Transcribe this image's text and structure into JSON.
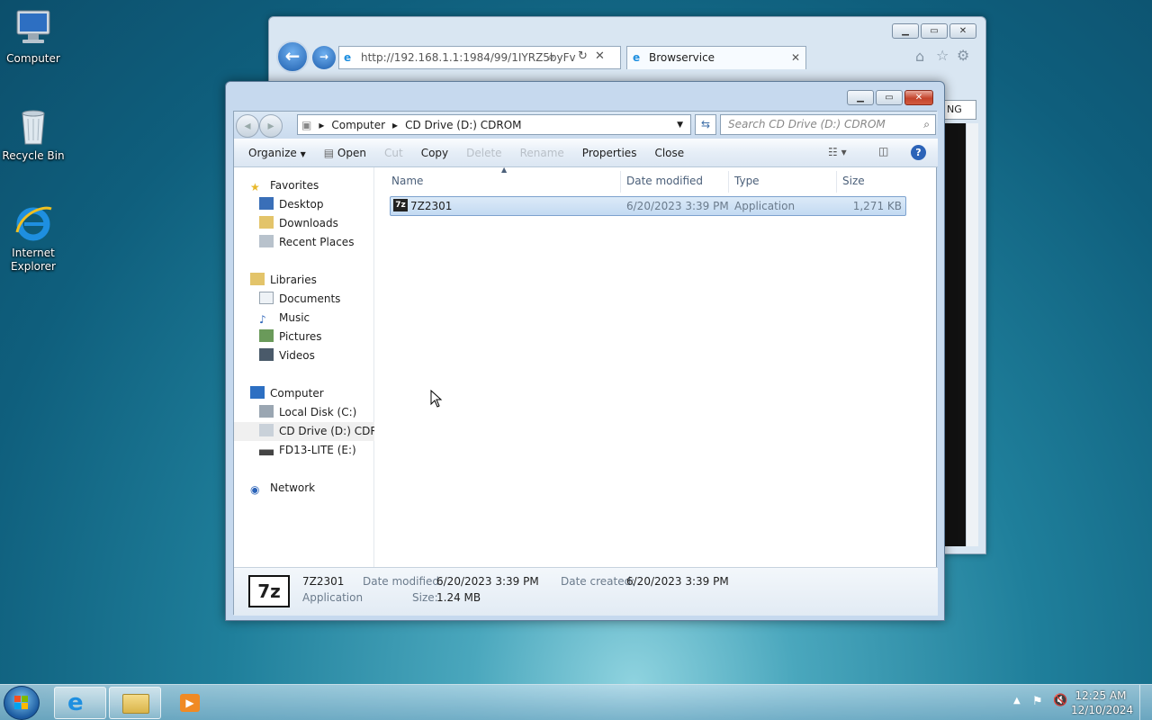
{
  "desktop": {
    "icons": [
      {
        "label": "Computer",
        "icon": "computer-icon"
      },
      {
        "label": "Recycle Bin",
        "icon": "recycle-bin-icon"
      },
      {
        "label": "Internet Explorer",
        "icon": "internet-explorer-icon"
      }
    ]
  },
  "browser": {
    "address": "http://192.168.1.1:1984/99/1IYRZ5byFv",
    "tab_title": "Browservice",
    "partial_text": "NG"
  },
  "explorer": {
    "breadcrumb": [
      "Computer",
      "CD Drive (D:) CDROM"
    ],
    "search_placeholder": "Search CD Drive (D:) CDROM",
    "commands": {
      "organize": "Organize",
      "open": "Open",
      "cut": "Cut",
      "copy": "Copy",
      "delete": "Delete",
      "rename": "Rename",
      "properties": "Properties",
      "close": "Close"
    },
    "nav": {
      "favorites": "Favorites",
      "desktop": "Desktop",
      "downloads": "Downloads",
      "recent_places": "Recent Places",
      "libraries": "Libraries",
      "documents": "Documents",
      "music": "Music",
      "pictures": "Pictures",
      "videos": "Videos",
      "computer": "Computer",
      "local_disk": "Local Disk (C:)",
      "cd_drive": "CD Drive (D:) CDROM",
      "fd13": "FD13-LITE (E:)",
      "network": "Network"
    },
    "columns": {
      "name": "Name",
      "date_modified": "Date modified",
      "type": "Type",
      "size": "Size"
    },
    "files": [
      {
        "name": "7Z2301",
        "date_modified": "6/20/2023 3:39 PM",
        "type": "Application",
        "size": "1,271 KB"
      }
    ],
    "details": {
      "icon_text": "7z",
      "name": "7Z2301",
      "type": "Application",
      "date_modified_label": "Date modified:",
      "date_modified": "6/20/2023 3:39 PM",
      "date_created_label": "Date created:",
      "date_created": "6/20/2023 3:39 PM",
      "size_label": "Size:",
      "size": "1.24 MB"
    }
  },
  "taskbar": {
    "time": "12:25 AM",
    "date": "12/10/2024"
  }
}
